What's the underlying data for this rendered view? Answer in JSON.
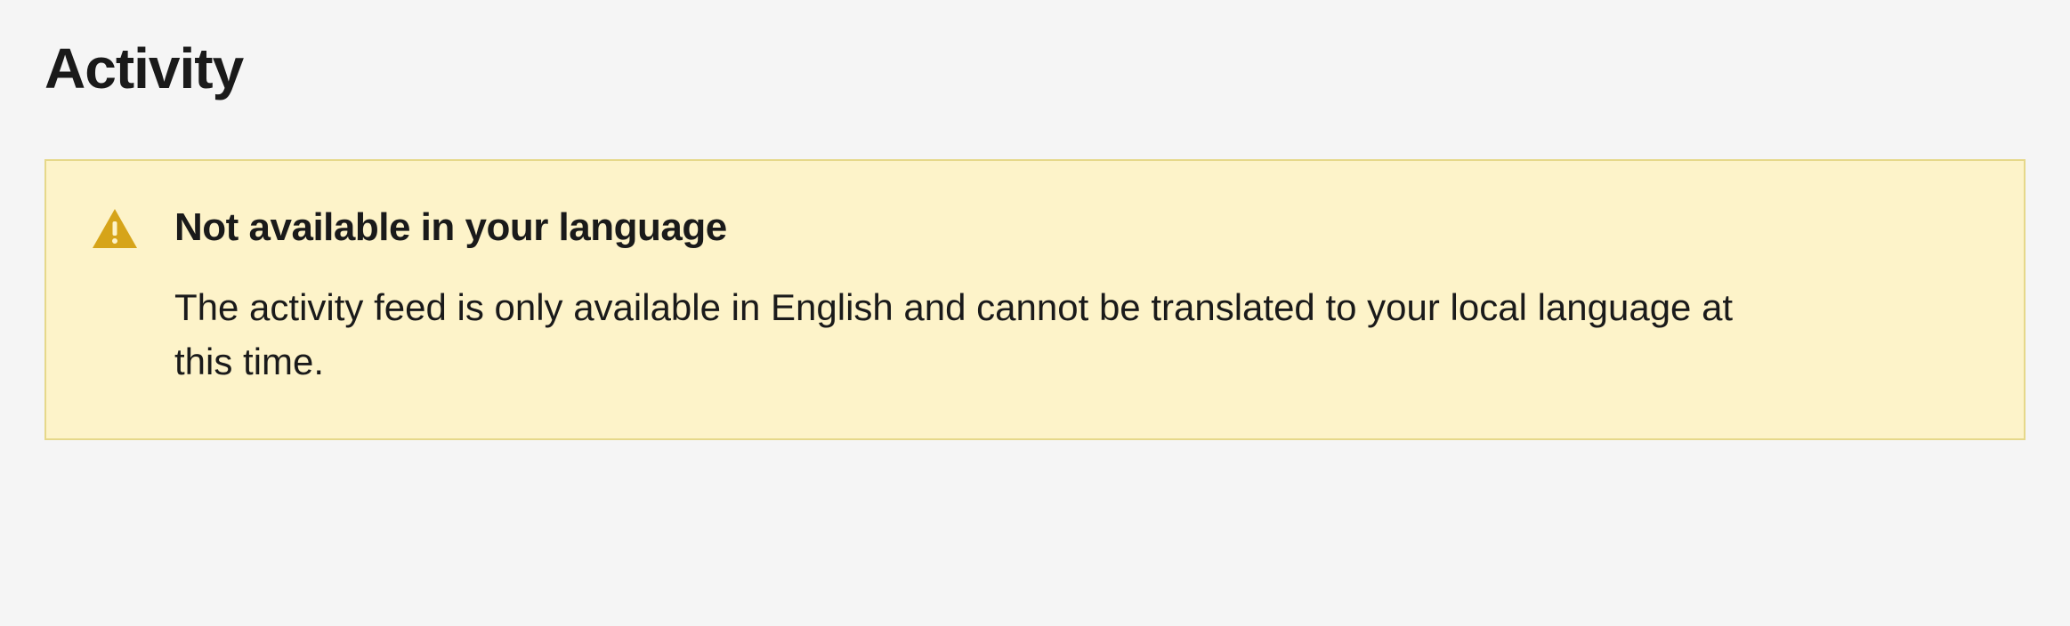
{
  "header": {
    "title": "Activity"
  },
  "notice": {
    "icon": "warning-triangle",
    "title": "Not available in your language",
    "message": "The activity feed is only available in English and cannot be translated to your local language at this time.",
    "colors": {
      "background": "#fdf3c9",
      "border": "#e6d88a",
      "icon": "#d6a419"
    }
  }
}
